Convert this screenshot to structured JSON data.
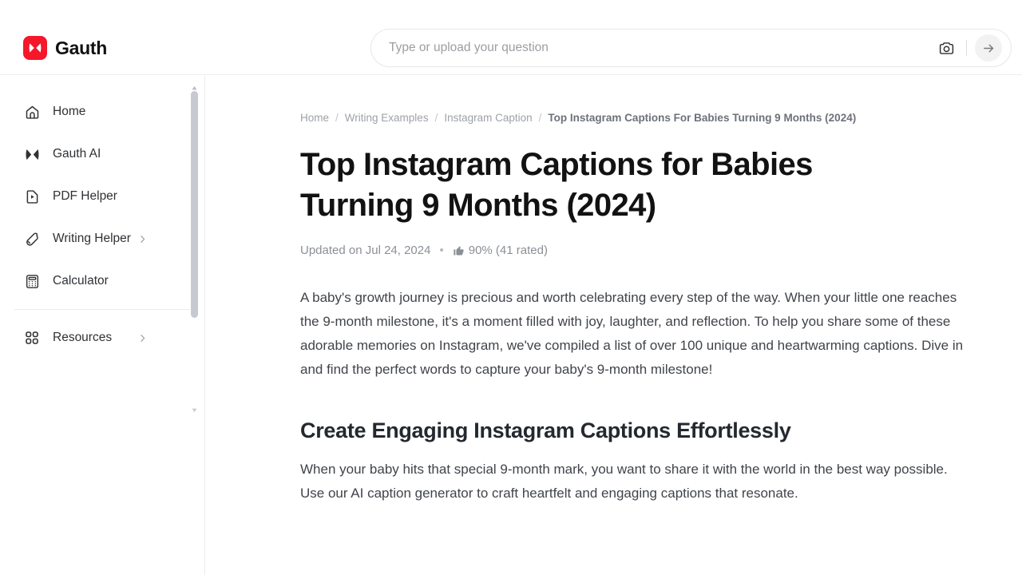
{
  "header": {
    "brand_name": "Gauth",
    "logo_icon": "gauth-logo-icon",
    "search": {
      "placeholder": "Type or upload your question",
      "value": "",
      "camera_icon": "camera-icon",
      "submit_icon": "arrow-right-icon"
    }
  },
  "sidebar": {
    "items": [
      {
        "label": "Home",
        "icon": "home-icon",
        "chevron": false
      },
      {
        "label": "Gauth AI",
        "icon": "gauth-ai-icon",
        "chevron": false
      },
      {
        "label": "PDF Helper",
        "icon": "pdf-helper-icon",
        "chevron": false
      },
      {
        "label": "Writing Helper",
        "icon": "pen-icon",
        "chevron": true
      },
      {
        "label": "Calculator",
        "icon": "calculator-icon",
        "chevron": false
      }
    ],
    "secondary_items": [
      {
        "label": "Resources",
        "icon": "grid-apps-icon",
        "chevron": true
      }
    ],
    "scrollbar": {
      "up_icon": "scroll-up-arrow-icon",
      "down_icon": "scroll-down-arrow-icon"
    }
  },
  "main": {
    "breadcrumb": {
      "items": [
        "Home",
        "Writing Examples",
        "Instagram Caption"
      ],
      "separator": "/",
      "current": "Top Instagram Captions For Babies Turning 9 Months (2024)"
    },
    "title": "Top Instagram Captions for Babies Turning 9 Months (2024)",
    "meta": {
      "updated": "Updated on Jul 24, 2024",
      "dot": "•",
      "thumbs_up_icon": "thumbs-up-icon",
      "rating": "90% (41 rated)"
    },
    "intro_paragraph": "A baby's growth journey is precious and worth celebrating every step of the way. When your little one reaches the 9-month milestone, it's a moment filled with joy, laughter, and reflection. To help you share some of these adorable memories on Instagram, we've compiled a list of over 100 unique and heartwarming captions. Dive in and find the perfect words to capture your baby's 9-month milestone!",
    "section_heading": "Create Engaging Instagram Captions Effortlessly",
    "section_paragraph": "When your baby hits that special 9-month mark, you want to share it with the world in the best way possible. Use our AI caption generator to craft heartfelt and engaging captions that resonate."
  },
  "colors": {
    "brand_red": "#f5172a",
    "text_dark": "#121212",
    "text_body": "#40444a",
    "text_muted": "#9da1a8",
    "border": "#ededed"
  }
}
